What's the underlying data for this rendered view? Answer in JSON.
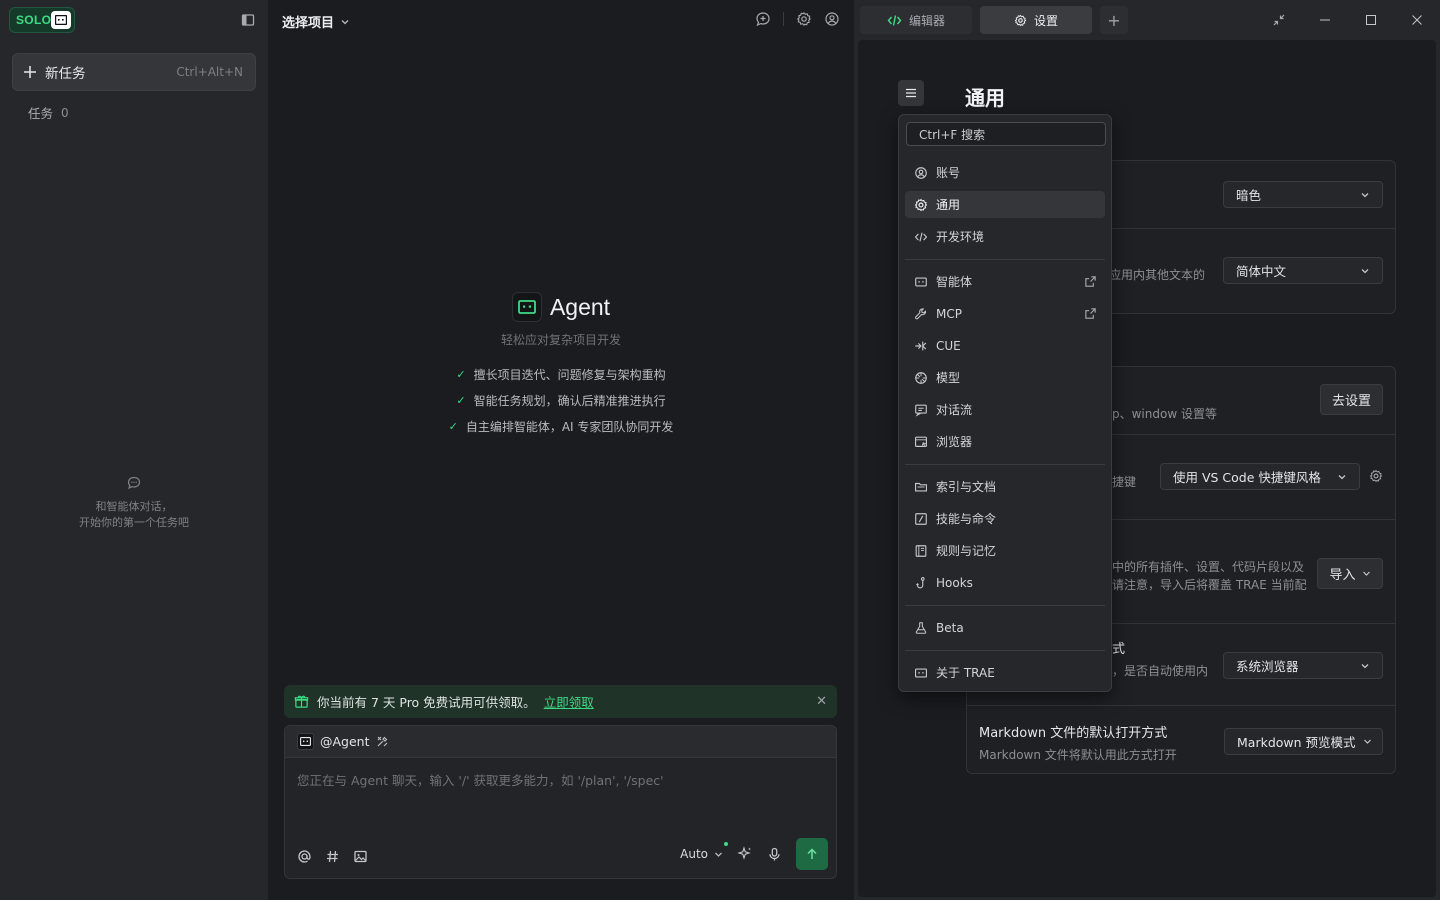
{
  "sidebar": {
    "brand": "SOLO",
    "new_task_label": "新任务",
    "new_task_shortcut": "Ctrl+Alt+N",
    "tasks_label": "任务",
    "tasks_count": "0",
    "empty_line1": "和智能体对话，",
    "empty_line2": "开始你的第一个任务吧"
  },
  "middle": {
    "project_select": "选择项目",
    "agent_title": "Agent",
    "agent_subtitle": "轻松应对复杂项目开发",
    "features": [
      "擅长项目迭代、问题修复与架构重构",
      "智能任务规划，确认后精准推进执行",
      "自主编排智能体，AI 专家团队协同开发"
    ],
    "promo_text": "你当前有 7 天 Pro 免费试用可供领取。",
    "promo_link": "立即领取",
    "mention": "@Agent",
    "input_placeholder": "您正在与 Agent 聊天，输入 '/' 获取更多能力，如 '/plan', '/spec'",
    "model_select": "Auto"
  },
  "tabs": {
    "editor": "编辑器",
    "settings": "设置"
  },
  "settings": {
    "title": "通用",
    "theme_value": "暗色",
    "lang_desc": "应用内其他文本的",
    "lang_value": "简体中文",
    "import_desc": "p、window 设置等",
    "import_btn": "去设置",
    "keybind_desc": "捷键",
    "keybind_value": "使用 VS Code 快捷键风格",
    "migrate_desc1": "中的所有插件、设置、代码片段以及",
    "migrate_desc2": "请注意，导入后将覆盖 TRAE 当前配",
    "migrate_btn": "导入",
    "browser_title_frag": "式",
    "browser_desc": "，是否自动使用内",
    "browser_value": "系统浏览器",
    "md_title": "Markdown 文件的默认打开方式",
    "md_desc": "Markdown 文件将默认用此方式打开",
    "md_value": "Markdown 预览模式"
  },
  "nav": {
    "search": "Ctrl+F 搜索",
    "items": [
      {
        "label": "账号",
        "icon": "user-circle-icon"
      },
      {
        "label": "通用",
        "icon": "gear-icon"
      },
      {
        "label": "开发环境",
        "icon": "code-icon"
      },
      {
        "label": "智能体",
        "icon": "bot-icon"
      },
      {
        "label": "MCP",
        "icon": "wrench-icon"
      },
      {
        "label": "CUE",
        "icon": "cue-icon"
      },
      {
        "label": "模型",
        "icon": "model-icon"
      },
      {
        "label": "对话流",
        "icon": "chat-flow-icon"
      },
      {
        "label": "浏览器",
        "icon": "browser-icon"
      },
      {
        "label": "索引与文档",
        "icon": "folder-icon"
      },
      {
        "label": "技能与命令",
        "icon": "slash-icon"
      },
      {
        "label": "规则与记忆",
        "icon": "book-icon"
      },
      {
        "label": "Hooks",
        "icon": "hook-icon"
      },
      {
        "label": "Beta",
        "icon": "flask-icon"
      },
      {
        "label": "关于 TRAE",
        "icon": "trae-icon"
      }
    ]
  },
  "colors": {
    "accent_green": "#3ddc84",
    "send_button": "#1e6b43",
    "promo_bg": "#1f3328"
  }
}
